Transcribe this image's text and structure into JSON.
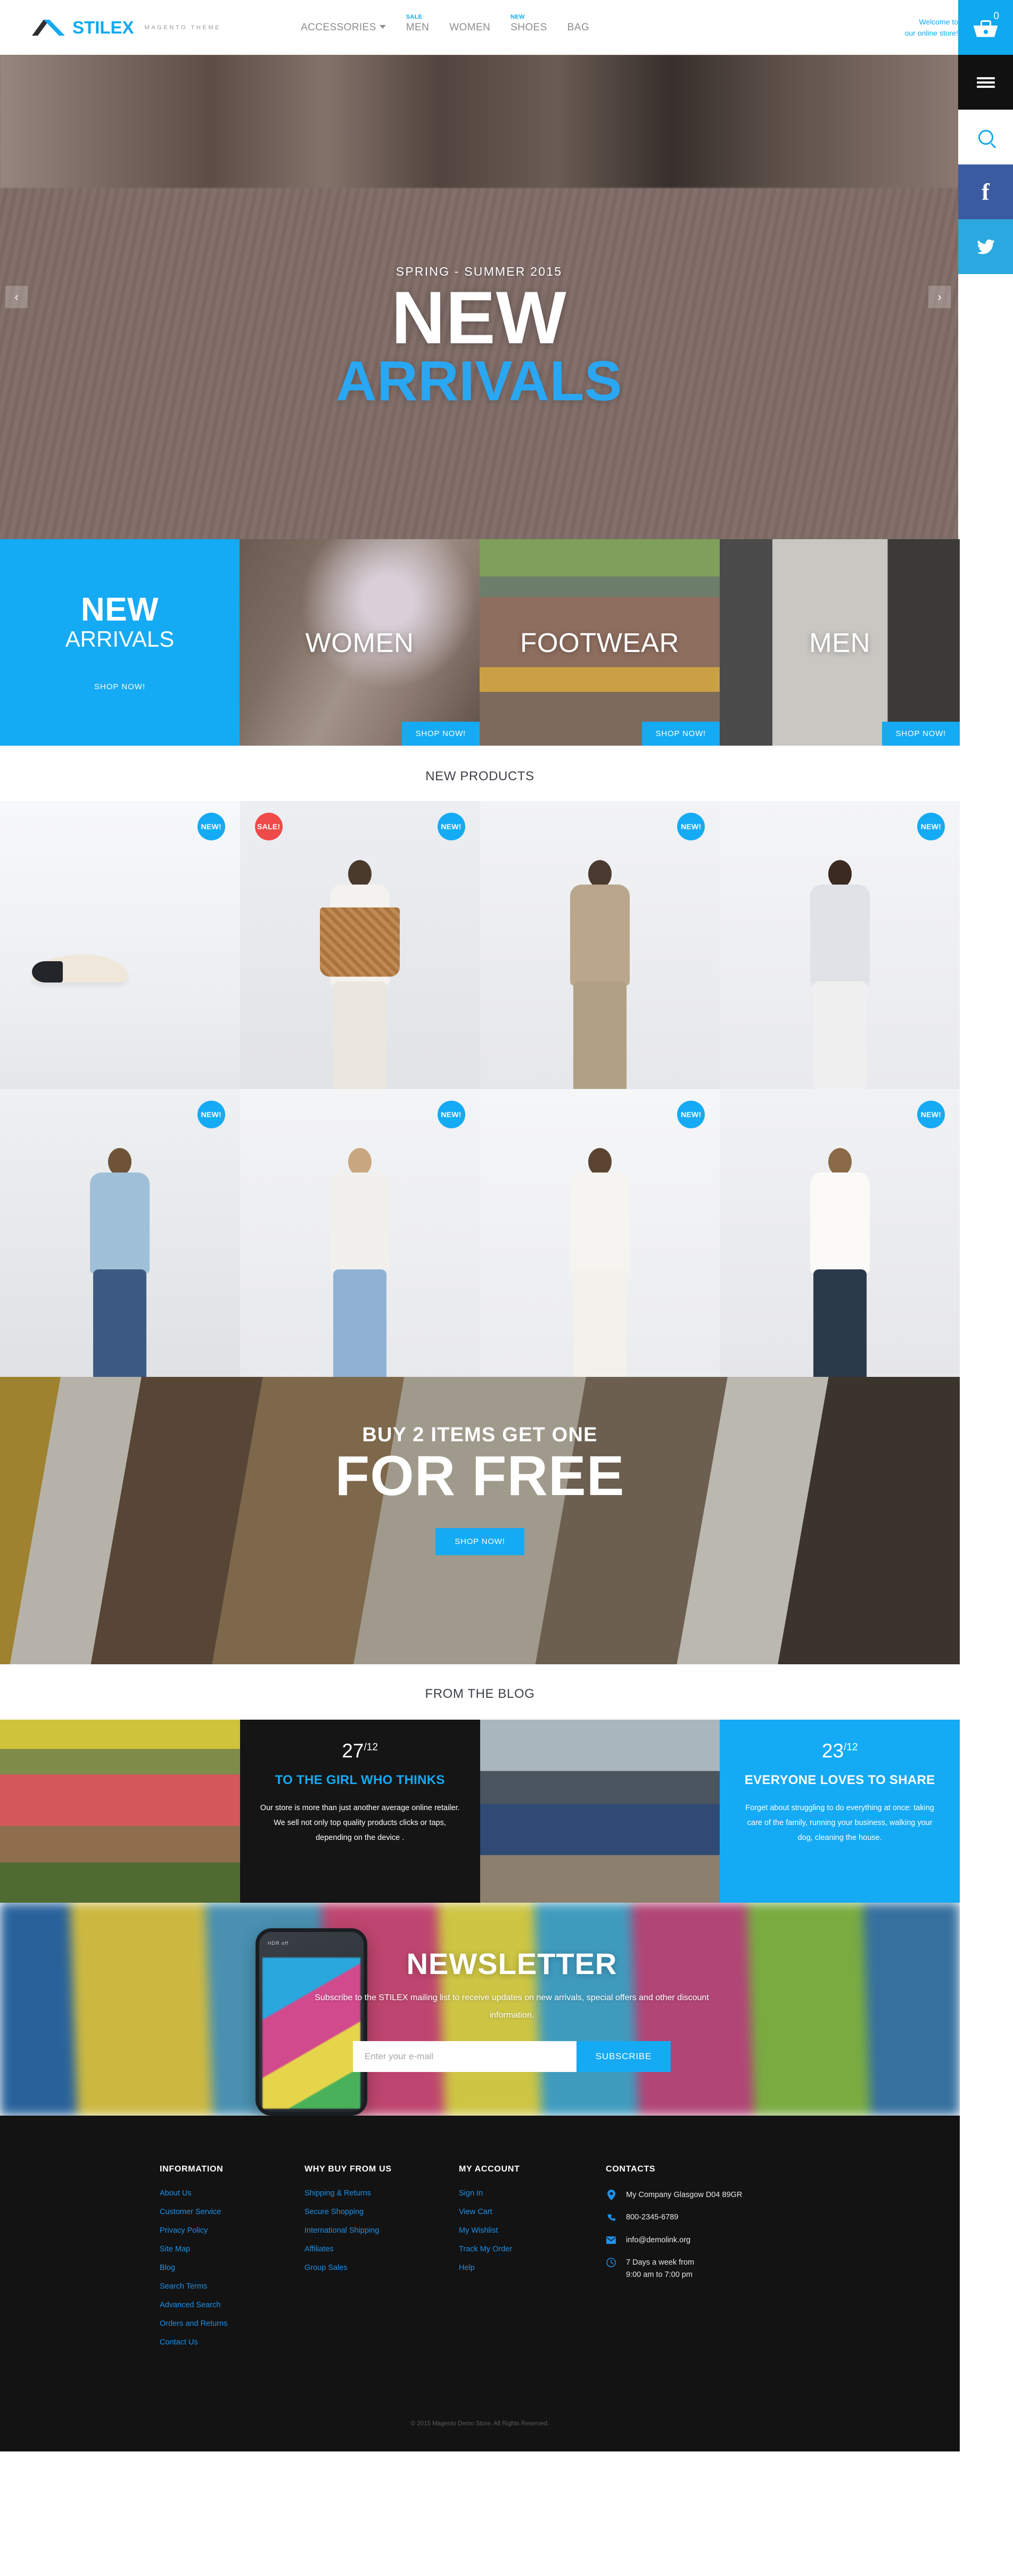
{
  "brand": {
    "logo_text": "STILEX",
    "logo_sub": "MAGENTO THEME",
    "accent": "#15aaf4",
    "sale_red": "#f04a4a"
  },
  "header": {
    "welcome_line1": "Welcome to",
    "welcome_line2": "our online store!",
    "cart_count": "0",
    "nav": [
      {
        "label": "ACCESSORIES",
        "tag": "",
        "has_caret": true
      },
      {
        "label": "MEN",
        "tag": "SALE",
        "has_caret": false
      },
      {
        "label": "WOMEN",
        "tag": "",
        "has_caret": false
      },
      {
        "label": "SHOES",
        "tag": "NEW",
        "has_caret": false
      },
      {
        "label": "BAG",
        "tag": "",
        "has_caret": false
      }
    ],
    "rail": {
      "cart_icon": "shopping-basket-icon",
      "menu_icon": "hamburger-menu-icon",
      "search_icon": "search-icon",
      "facebook_icon": "facebook-icon",
      "facebook_glyph": "f",
      "twitter_icon": "twitter-icon",
      "twitter_glyph": "✈"
    }
  },
  "hero": {
    "kicker": "SPRING - SUMMER 2015",
    "title": "NEW",
    "subtitle": "ARRIVALS",
    "prev": "‹",
    "next": "›"
  },
  "categories": [
    {
      "kind": "promo",
      "title": "NEW",
      "subtitle": "ARRIVALS",
      "link": "SHOP NOW!"
    },
    {
      "kind": "image",
      "title": "WOMEN",
      "button": "SHOP NOW!"
    },
    {
      "kind": "image",
      "title": "FOOTWEAR",
      "button": "SHOP NOW!"
    },
    {
      "kind": "image",
      "title": "MEN",
      "button": "SHOP NOW!"
    }
  ],
  "new_products": {
    "title": "NEW PRODUCTS",
    "items": [
      {
        "badge": "NEW!",
        "badge_type": "new"
      },
      {
        "badge": "SALE!",
        "badge_type": "sale"
      },
      {
        "badge": "NEW!",
        "badge_type": "new"
      },
      {
        "badge": "NEW!",
        "badge_type": "new"
      },
      {
        "badge": "NEW!",
        "badge_type": "new"
      },
      {
        "badge": "NEW!",
        "badge_type": "new"
      },
      {
        "badge": "NEW!",
        "badge_type": "new"
      },
      {
        "badge": "NEW!",
        "badge_type": "new"
      }
    ]
  },
  "promo_banner": {
    "line1": "BUY 2 ITEMS GET ONE",
    "line2": "FOR FREE",
    "button": "SHOP NOW!"
  },
  "blog": {
    "title": "FROM THE BLOG",
    "posts": [
      {
        "day": "27",
        "month": "/12",
        "heading": "TO THE GIRL WHO THINKS",
        "body": "Our store is more than just another average online retailer. We sell not only top quality products clicks or taps, depending on the device ."
      },
      {
        "day": "23",
        "month": "/12",
        "heading": "EVERYONE LOVES TO SHARE",
        "body": "Forget about struggling to do everything at once: taking care of the family, running your business, walking your dog, cleaning the house."
      }
    ]
  },
  "newsletter": {
    "title": "NEWSLETTER",
    "description": "Subscribe to the STILEX mailing list to receive updates on new arrivals, special offers and other discount information.",
    "placeholder": "Enter your e-mail",
    "value": "",
    "button": "SUBSCRIBE",
    "phone_label": "HDR off"
  },
  "footer": {
    "columns": [
      {
        "heading": "INFORMATION",
        "links": [
          "About Us",
          "Customer Service",
          "Privacy Policy",
          "Site Map",
          "Blog",
          "Search Terms",
          "Advanced Search",
          "Orders and Returns",
          "Contact Us"
        ]
      },
      {
        "heading": "WHY BUY FROM US",
        "links": [
          "Shipping & Returns",
          "Secure Shopping",
          "International Shipping",
          "Affiliates",
          "Group Sales"
        ]
      },
      {
        "heading": "MY ACCOUNT",
        "links": [
          "Sign In",
          "View Cart",
          "My Wishlist",
          "Track My Order",
          "Help"
        ]
      }
    ],
    "contacts": {
      "heading": "CONTACTS",
      "rows": [
        {
          "icon": "location-pin-icon",
          "glyph": "⊕",
          "text": "My Company Glasgow D04 89GR"
        },
        {
          "icon": "phone-icon",
          "glyph": "✆",
          "text": "800-2345-6789"
        },
        {
          "icon": "email-icon",
          "glyph": "✉",
          "text": "info@demolink.org"
        },
        {
          "icon": "clock-icon",
          "glyph": "◴",
          "text": "7 Days a week from\n9:00 am to 7:00 pm"
        }
      ]
    },
    "copyright": "© 2015 Magento Demo Store. All Rights Reserved."
  }
}
